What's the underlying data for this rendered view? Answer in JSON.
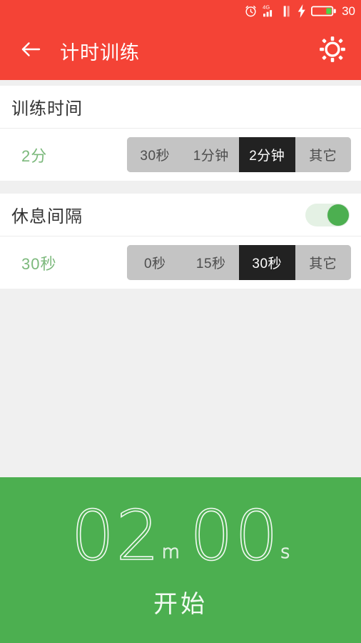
{
  "theme": {
    "header_red": "#f44336",
    "accent_green": "#4caf50",
    "value_green": "#7cb97c",
    "segment_track": "#c4c4c4",
    "segment_active": "#222222",
    "page_bg": "#f0f0f0"
  },
  "statusbar": {
    "alarm_icon": "alarm-clock-icon",
    "network_icon": "signal-4g-icon",
    "network_label": "4G",
    "signal_icon": "signal-bars-icon",
    "charging_icon": "lightning-bolt-icon",
    "battery_icon": "battery-icon",
    "battery_level": "30"
  },
  "appbar": {
    "back_icon": "arrow-left-icon",
    "title": "计时训练",
    "settings_icon": "gear-icon"
  },
  "sections": [
    {
      "id": "training-time",
      "title": "训练时间",
      "has_toggle": false,
      "value": "2分",
      "options": [
        "30秒",
        "1分钟",
        "2分钟",
        "其它"
      ],
      "selected_index": 2
    },
    {
      "id": "rest-interval",
      "title": "休息间隔",
      "has_toggle": true,
      "toggle_on": true,
      "value": "30秒",
      "options": [
        "0秒",
        "15秒",
        "30秒",
        "其它"
      ],
      "selected_index": 2
    }
  ],
  "footer": {
    "minutes": "02",
    "minutes_unit": "m",
    "seconds": "00",
    "seconds_unit": "s",
    "start_label": "开始"
  }
}
